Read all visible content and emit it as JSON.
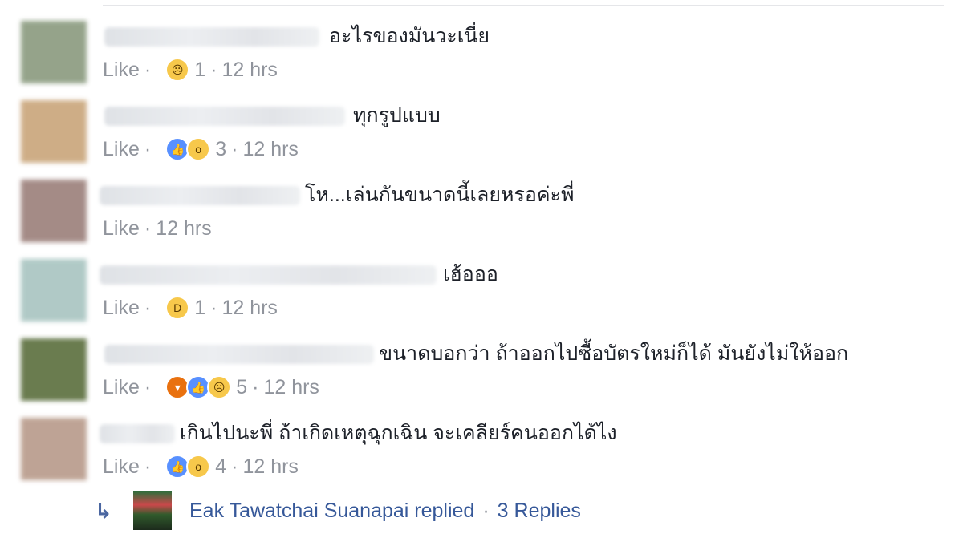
{
  "comments": [
    {
      "text": "อะไรของมันวะเนี่ย",
      "like_label": "Like",
      "reactions": [
        "sad"
      ],
      "reaction_count": "1",
      "time": "12 hrs"
    },
    {
      "text": "ทุกรูปแบบ",
      "like_label": "Like",
      "reactions": [
        "like",
        "wow"
      ],
      "reaction_count": "3",
      "time": "12 hrs"
    },
    {
      "text": "โห...เล่นกันขนาดนี้เลยหรอค่ะพี่",
      "like_label": "Like",
      "reactions": [],
      "reaction_count": "",
      "time": "12 hrs"
    },
    {
      "text": "เฮ้อออ",
      "like_label": "Like",
      "reactions": [
        "haha"
      ],
      "reaction_count": "1",
      "time": "12 hrs"
    },
    {
      "text": "ขนาดบอกว่า ถ้าออกไปซื้อบัตรใหม่ก็ได้ มันยังไม่ให้ออก",
      "like_label": "Like",
      "reactions": [
        "angry",
        "like",
        "sad"
      ],
      "reaction_count": "5",
      "time": "12 hrs"
    },
    {
      "text": "เกินไปนะพี่ ถ้าเกิดเหตุฉุกเฉิน จะเคลียร์คนออกได้ไง",
      "like_label": "Like",
      "reactions": [
        "like",
        "wow"
      ],
      "reaction_count": "4",
      "time": "12 hrs"
    }
  ],
  "reply": {
    "name": "Eak Tawatchai Suanapai replied",
    "separator": "·",
    "count": "3 Replies"
  },
  "separator": "·"
}
